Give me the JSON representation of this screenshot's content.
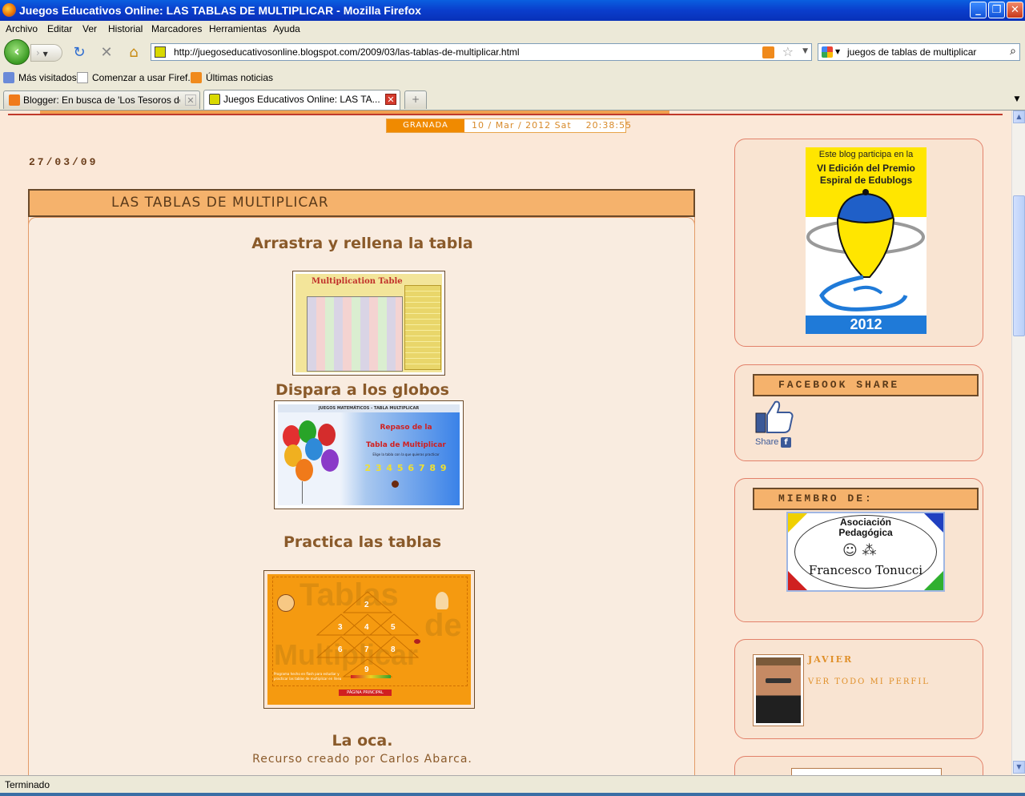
{
  "window": {
    "title": "Juegos Educativos Online: LAS TABLAS DE MULTIPLICAR - Mozilla Firefox"
  },
  "menu": [
    "Archivo",
    "Editar",
    "Ver",
    "Historial",
    "Marcadores",
    "Herramientas",
    "Ayuda"
  ],
  "nav": {
    "url": "http://juegoseducativosonline.blogspot.com/2009/03/las-tablas-de-multiplicar.html",
    "search_value": "juegos de tablas de multiplicar"
  },
  "bookmarks": [
    "Más visitados",
    "Comenzar a usar Firef...",
    "Últimas noticias"
  ],
  "tabs": [
    {
      "label": "Blogger: En busca de 'Los Tesoros del ...",
      "active": false
    },
    {
      "label": "Juegos Educativos Online: LAS TA...",
      "active": true
    }
  ],
  "clock": {
    "city": "GRANADA",
    "datetime": "10 / Mar / 2012 Sat    20:38:55"
  },
  "post": {
    "date": "27/03/09",
    "title": "LAS TABLAS DE MULTIPLICAR",
    "sections": [
      "Arrastra y rellena la tabla",
      "Dispara a los globos",
      "Practica las tablas",
      "La oca."
    ],
    "credit": "Recurso creado por Carlos Abarca.",
    "thumb1": {
      "title": "Multiplication Table"
    },
    "thumb2": {
      "header": "JUEGOS MATEMÁTICOS - TABLA MULTIPLICAR",
      "line1": "Repaso de la",
      "line2": "Tabla de Multiplicar",
      "sub": "Elige la tabla con la que quieras practicar",
      "numbers": "2 3 4 5 6 7 8 9"
    },
    "thumb3": {
      "word1": "Tablas",
      "word2": "de",
      "word3": "Multiplicar",
      "caption": "Programa hecho en flash para estudiar y practicar las tablas de multiplicar en línea",
      "button": "PÁGINA PRINCIPAL",
      "numbers": [
        "2",
        "3",
        "4",
        "5",
        "6",
        "7",
        "8",
        "9"
      ]
    }
  },
  "sidebar": {
    "award": {
      "line1": "Este blog participa en la",
      "line2": "VI Edición del Premio",
      "line3": "Espiral de Edublogs",
      "year": "2012"
    },
    "facebook": {
      "heading": "FACEBOOK SHARE",
      "share_label": "Share"
    },
    "member": {
      "heading": "MIEMBRO DE:",
      "logo_line1": "Asociación",
      "logo_line2": "Pedagógica",
      "logo_name": "Francesco Tonucci"
    },
    "profile": {
      "name": "JAVIER",
      "link": "VER TODO MI PERFIL"
    }
  },
  "status": {
    "text": "Terminado"
  }
}
